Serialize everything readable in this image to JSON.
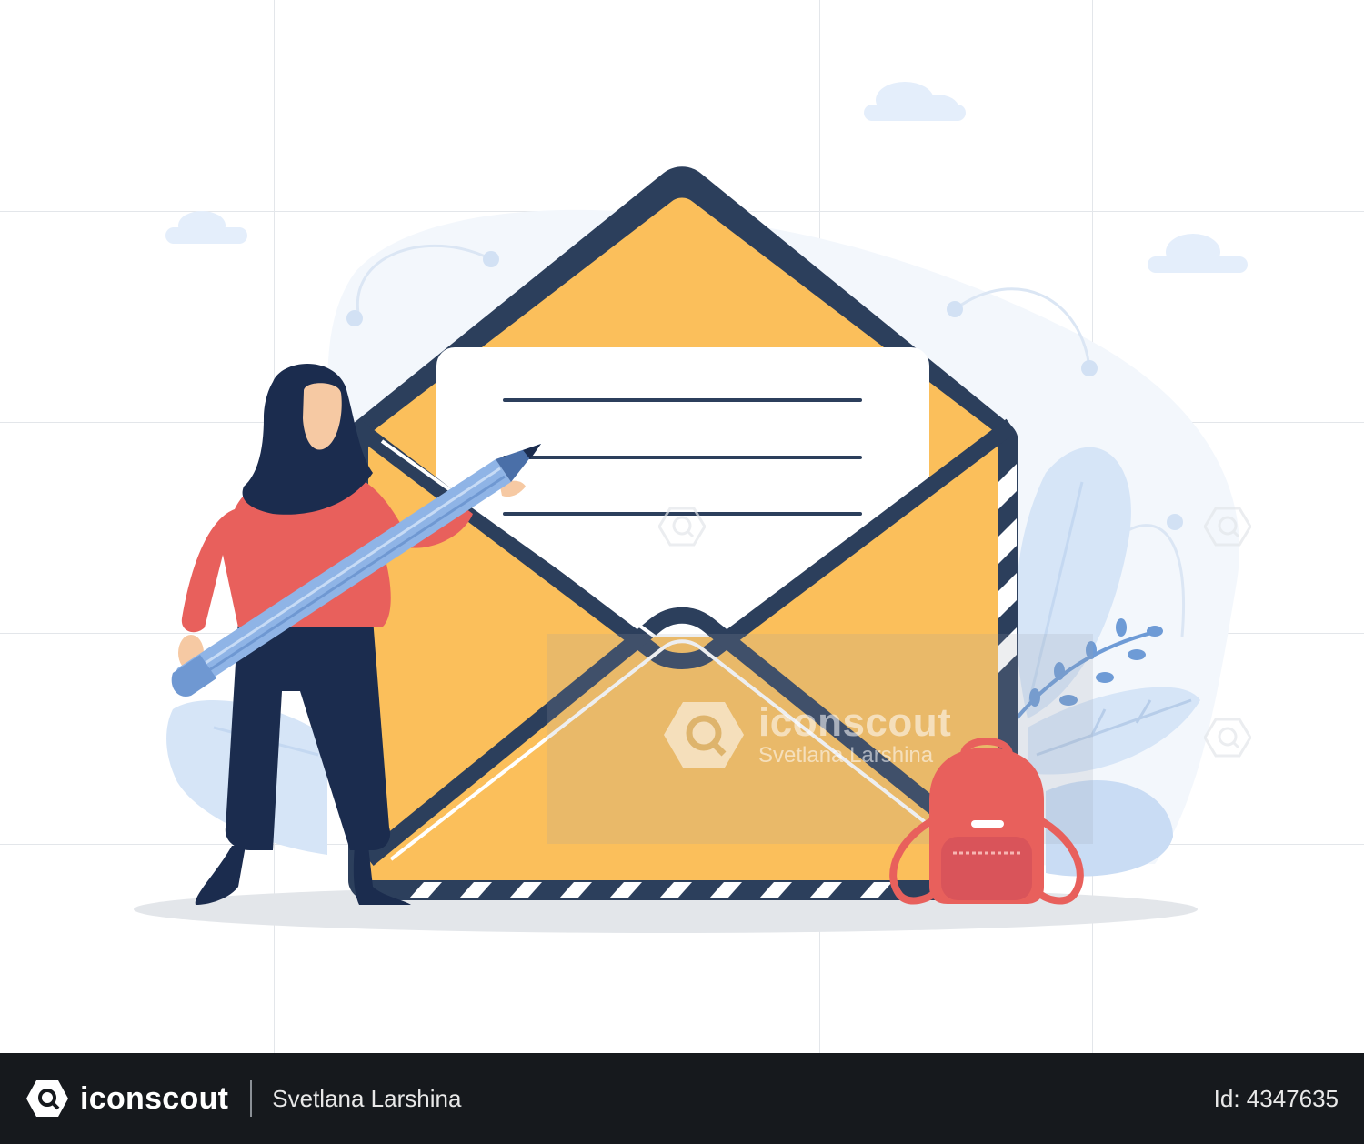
{
  "watermark": {
    "brand": "iconscout",
    "author": "Svetlana Larshina"
  },
  "footer": {
    "brand": "iconscout",
    "author": "Svetlana Larshina",
    "id_label": "Id: 4347635"
  },
  "colors": {
    "envelope_yellow": "#fbbf5b",
    "envelope_dark": "#2c3f5c",
    "paper": "#ffffff",
    "hijab": "#1b2c4e",
    "sweater": "#e8605c",
    "pencil": "#8fb4e6",
    "backpack": "#d9545a",
    "foliage": "#c9dcf4",
    "footer_bg": "#16191d"
  },
  "icons": [
    "iconscout-logo-icon",
    "pencil-icon",
    "envelope-icon",
    "backpack-icon",
    "cloud-icon",
    "leaf-icon"
  ]
}
